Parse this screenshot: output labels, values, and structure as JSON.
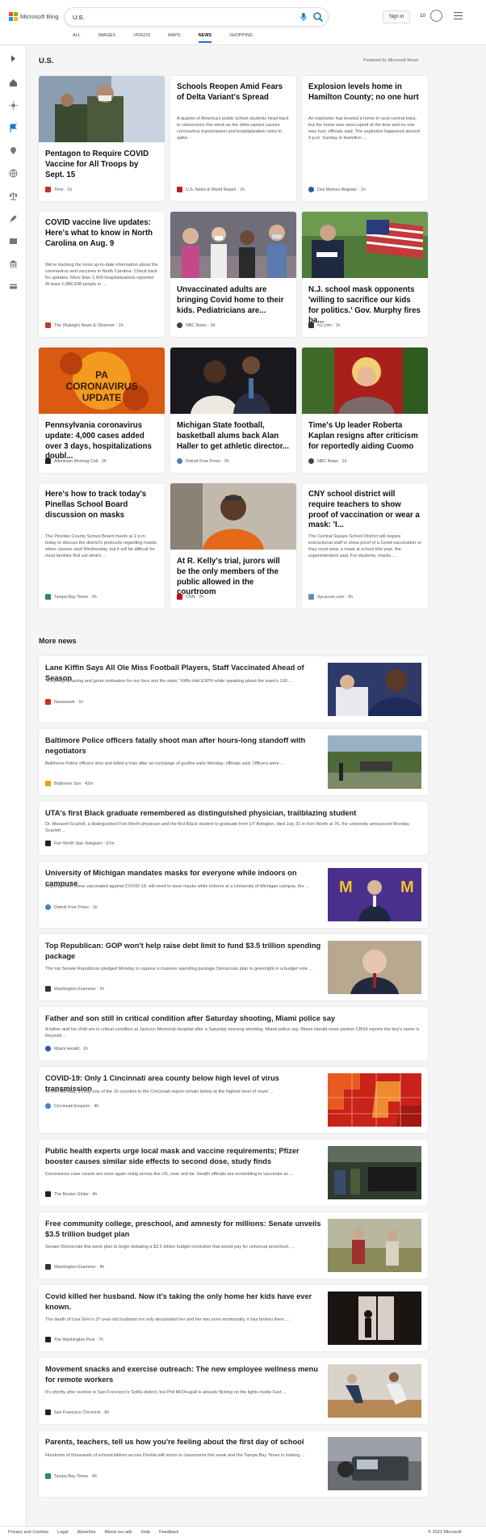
{
  "header": {
    "logo_text": "Microsoft Bing",
    "search_value": "U.S.",
    "signin": "Sign in",
    "points": "10"
  },
  "tabs": [
    {
      "label": "ALL"
    },
    {
      "label": "IMAGES"
    },
    {
      "label": "VIDEOS"
    },
    {
      "label": "MAPS"
    },
    {
      "label": "NEWS"
    },
    {
      "label": "SHOPPING"
    }
  ],
  "section_title": "U.S.",
  "powered_by": "Powered by Microsoft News",
  "top_cards": [
    {
      "title": "Pentagon to Require COVID Vaccine for All Troops by Sept. 15",
      "snippet": "",
      "source": "Time",
      "age": "1h",
      "dot": "#c4302b"
    },
    {
      "title": "Schools Reopen Amid Fears of Delta Variant's Spread",
      "snippet": "A quarter of America's public school students head back to classrooms this week as the delta variant causes coronavirus transmission and hospitalization rates to spike.",
      "source": "U.S. News & World Report",
      "age": "1h",
      "dot": "#b22"
    },
    {
      "title": "Explosion levels home in Hamilton County; no one hurt",
      "snippet": "An explosion has leveled a home in rural central Iowa, but the home was unoccupied at the time and no one was hurt, officials said. The explosion happened around 9 p.m. Sunday in Hamilton ...",
      "source": "Des Moines Register",
      "age": "1h",
      "dot": "#2b5aa0"
    },
    {
      "title": "COVID vaccine live updates: Here's what to know in North Carolina on Aug. 9",
      "snippet": "We're tracking the most up-to-date information about the coronavirus and vaccines in North Carolina. Check back for updates. More than 1,900 hospitalizations reported At least 1,086,938 people in ...",
      "source": "The (Raleigh) News & Observer",
      "age": "1h",
      "dot": "#c0392b"
    },
    {
      "title": "Unvaccinated adults are bringing Covid home to their kids. Pediatricians are...",
      "snippet": "",
      "source": "NBC News",
      "age": "3h",
      "dot": "#444"
    },
    {
      "title": "N.J. school mask opponents 'willing to sacrifice our kids for politics.' Gov. Murphy fires ba...",
      "snippet": "",
      "source": "NJ.com",
      "age": "1h",
      "dot": "#333"
    },
    {
      "title": "Pennsylvania coronavirus update: 4,000 cases added over 3 days, hospitalizations doubl...",
      "snippet": "",
      "source": "Allentown Morning Call",
      "age": "2h",
      "dot": "#222"
    },
    {
      "title": "Michigan State football, basketball alums back Alan Haller to get athletic director...",
      "snippet": "",
      "source": "Detroit Free Press",
      "age": "2h",
      "dot": "#4a7fc0"
    },
    {
      "title": "Time's Up leader Roberta Kaplan resigns after criticism for reportedly aiding Cuomo",
      "snippet": "",
      "source": "NBC News",
      "age": "1h",
      "dot": "#444"
    },
    {
      "title": "Here's how to track today's Pinellas School Board discussion on masks",
      "snippet": "The Pinellas County School Board meets at 1 p.m. today to discuss the district's protocols regarding masks when classes start Wednesday, but it will be difficult for most families find out what's ...",
      "source": "Tampa Bay Times",
      "age": "2h",
      "dot": "#2a8c5a"
    },
    {
      "title": "At R. Kelly's trial, jurors will be the only members of the public allowed in the courtroom",
      "snippet": "",
      "source": "CNN",
      "age": "7h",
      "dot": "#cc0000"
    },
    {
      "title": "CNY school district will require teachers to show proof of vaccination or wear a mask: 'I...",
      "snippet": "The Central Square School District will require instructional staff to show proof of a Covid vaccination or they must wear a mask at school this year, the superintendent said. For students, masks ...",
      "source": "Syracuse.com",
      "age": "5h",
      "dot": "#6a8ab0"
    }
  ],
  "more_title": "More news",
  "more_news": [
    {
      "title": "Lane Kiffin Says All Ole Miss Football Players, Staff Vaccinated Ahead of Season",
      "snippet": "\"It's pretty amazing and great motivation for our fans and the state,\" Kiffin told ESPN while speaking about the team's 100 ...",
      "source": "Newsweek",
      "age": "1h",
      "dot": "#d22"
    },
    {
      "title": "Baltimore Police officers fatally shoot man after hours-long standoff with negotiators",
      "snippet": "Baltimore Police officers shot and killed a man after an exchange of gunfire early Monday, officials said. Officers were ...",
      "source": "Baltimore Sun",
      "age": "42m",
      "dot": "#e5a800"
    },
    {
      "title": "UTA's first Black graduate remembered as distinguished physician, trailblazing student",
      "snippet": "Dr. Maxwell Scarlett, a distinguished Fort Worth physician and the first Black student to graduate from UT Arlington, died July 31 in Fort Worth at 76, the university announced Monday. Scarlett ...",
      "source": "Fort Worth Star-Telegram",
      "age": "57m",
      "dot": "#222"
    },
    {
      "title": "University of Michigan mandates masks for everyone while indoors on campuse",
      "snippet": "Anyone, even those vaccinated against COVID-19, will need to wear masks while indoors at a University of Michigan campus, the ...",
      "source": "Detroit Free Press",
      "age": "1h",
      "dot": "#4a7fc0"
    },
    {
      "title": "Top Republican: GOP won't help raise debt limit to fund $3.5 trillion spending package",
      "snippet": "The top Senate Republican pledged Monday to oppose a massive spending package Democrats plan to greenlight in a budget vote ...",
      "source": "Washington Examiner",
      "age": "1h",
      "dot": "#333"
    },
    {
      "title": "Father and son still in critical condition after Saturday shooting, Miami police say",
      "snippet": "A father and his child are in critical condition at Jackson Memorial Hospital after a Saturday morning shooting, Miami police say. Miami Herald news partner CBS4 reports the boy's name is Reynold ...",
      "source": "Miami Herald",
      "age": "1h",
      "dot": "#2b5aa0"
    },
    {
      "title": "COVID-19: Only 1 Cincinnati area county below high level of virus transmission",
      "snippet": "UPDATED Aug. 9 Only one of the 16 counties in the Cincinnati region remain below at the highest level of novel ...",
      "source": "Cincinnati Enquirer",
      "age": "4h",
      "dot": "#4a7fc0"
    },
    {
      "title": "Public health experts urge local mask and vaccine requirements; Pfizer booster causes similar side effects to second dose, study finds",
      "snippet": "Coronavirus case counts are once again rising across the US, near and far. Health officials are scrambling to vaccinate as ...",
      "source": "The Boston Globe",
      "age": "4h",
      "dot": "#222"
    },
    {
      "title": "Free community college, preschool, and amnesty for millions: Senate unveils $3.5 trillion budget plan",
      "snippet": "Senate Democrats this week plan to begin debating a $3.5 trillion budget resolution that would pay for universal preschool, ...",
      "source": "Washington Examiner",
      "age": "4h",
      "dot": "#333"
    },
    {
      "title": "Covid killed her husband. Now it's taking the only home her kids have ever known.",
      "snippet": "The death of Lisa Grim's 37-year-old husband not only devastated her and her two sons emotionally, it has broken them ...",
      "source": "The Washington Post",
      "age": "7h",
      "dot": "#222"
    },
    {
      "title": "Movement snacks and exercise outreach: The new employee wellness menu for remote workers",
      "snippet": "It's shortly after sunrise in San Francisco's SoMa district, but Phil McDougall is already flicking on the lights inside Fast ...",
      "source": "San Francisco Chronicle",
      "age": "8h",
      "dot": "#222"
    },
    {
      "title": "Parents, teachers, tell us how you're feeling about the first day of school",
      "snippet": "Hundreds of thousands of schoolchildren across Florida will return to classrooms this week and the Tampa Bay Times is looking ...",
      "source": "Tampa Bay Times",
      "age": "9h",
      "dot": "#2a8c5a"
    }
  ],
  "footer": {
    "links": [
      "Privacy and Cookies",
      "Legal",
      "Advertise",
      "About our ads",
      "Help",
      "Feedback"
    ],
    "copyright": "© 2021 Microsoft"
  }
}
